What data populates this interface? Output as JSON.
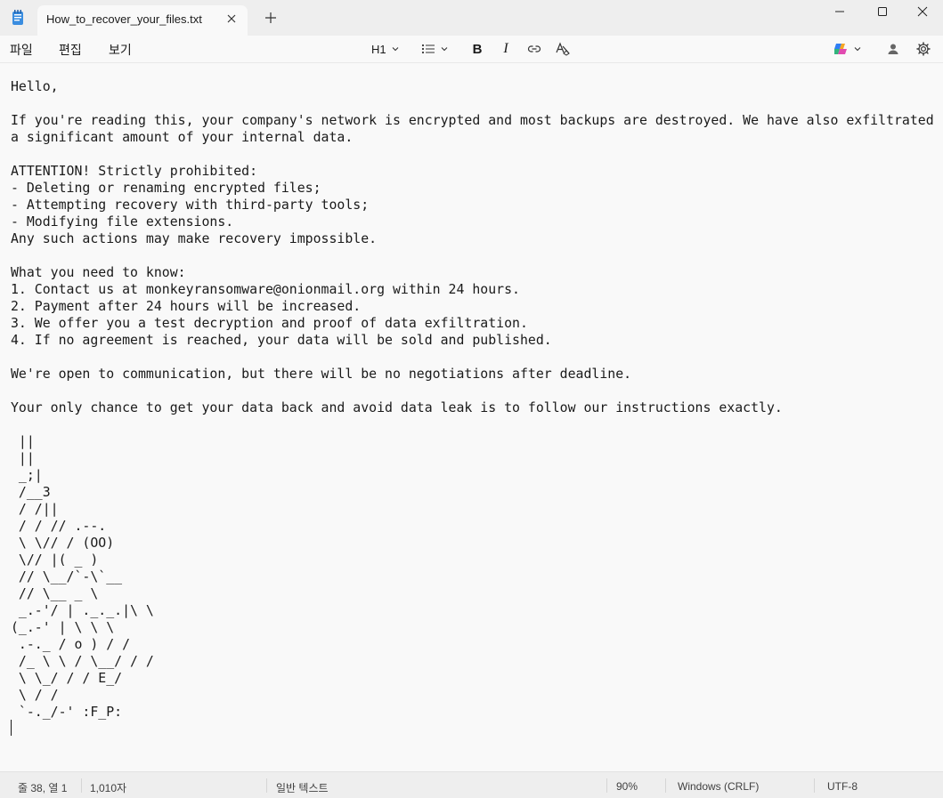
{
  "window": {
    "tab_title": "How_to_recover_your_files.txt",
    "icons": {
      "app": "notepad-icon",
      "close_tab": "close-icon",
      "new_tab": "plus-icon",
      "minimize": "minimize-icon",
      "maximize": "maximize-icon",
      "close": "close-icon"
    }
  },
  "menu": {
    "file": "파일",
    "edit": "편집",
    "view": "보기"
  },
  "toolbar": {
    "heading": "H1",
    "bold": "B",
    "italic": "I",
    "icons": {
      "list": "bulleted-list-icon",
      "link": "link-icon",
      "clear_format": "clear-formatting-icon",
      "copilot": "copilot-icon",
      "account": "account-icon",
      "settings": "gear-icon"
    },
    "accent_colors": [
      "#2f7ef5",
      "#e14ab0",
      "#f6a623",
      "#33b47c"
    ]
  },
  "document": {
    "text": "Hello,\n\nIf you're reading this, your company's network is encrypted and most backups are destroyed. We have also exfiltrated\na significant amount of your internal data.\n\nATTENTION! Strictly prohibited:\n- Deleting or renaming encrypted files;\n- Attempting recovery with third-party tools;\n- Modifying file extensions.\nAny such actions may make recovery impossible.\n\nWhat you need to know:\n1. Contact us at monkeyransomware@onionmail.org within 24 hours.\n2. Payment after 24 hours will be increased.\n3. We offer you a test decryption and proof of data exfiltration.\n4. If no agreement is reached, your data will be sold and published.\n\nWe're open to communication, but there will be no negotiations after deadline.\n\nYour only chance to get your data back and avoid data leak is to follow our instructions exactly.\n\n ||\n ||\n _;|\n /__3\n / /||\n / / // .--.\n \\ \\// / (OO)\n \\// |( _ )\n // \\__/`-\\`__\n // \\__ _ \\\n _.-'/ | ._._.|\\ \\\n(_.-' | \\ \\ \\\n .-._ / o ) / /\n /_ \\ \\ / \\__/ / /\n \\ \\_/ / / E_/\n \\ / /\n `-._/-' :F_P:"
  },
  "status": {
    "position": "줄 38, 열 1",
    "chars": "1,010자",
    "format": "일반 텍스트",
    "zoom": "90%",
    "line_endings": "Windows (CRLF)",
    "encoding": "UTF-8"
  }
}
